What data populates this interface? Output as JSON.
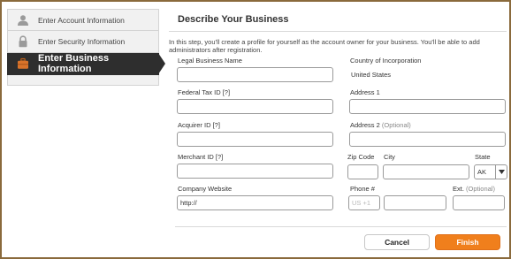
{
  "sidebar": {
    "items": [
      {
        "label": "Enter Account Information",
        "icon": "user-icon"
      },
      {
        "label": "Enter Security Information",
        "icon": "lock-icon"
      },
      {
        "label": "Enter Business Information",
        "icon": "briefcase-icon"
      }
    ]
  },
  "main": {
    "title": "Describe Your Business",
    "intro": "In this step, you'll create a profile for yourself as the account owner for your business. You'll be able to add administrators after registration."
  },
  "form": {
    "legal_business_name": {
      "label": "Legal Business Name",
      "value": ""
    },
    "country": {
      "label": "Country of Incorporation",
      "value": "United States"
    },
    "federal_tax_id": {
      "label": "Federal Tax ID [?]",
      "value": ""
    },
    "address1": {
      "label": "Address 1",
      "value": ""
    },
    "acquirer_id": {
      "label": "Acquirer ID  [?]",
      "value": ""
    },
    "address2": {
      "label": "Address 2",
      "optional": "(Optional)",
      "value": ""
    },
    "merchant_id": {
      "label": "Merchant ID [?]",
      "value": ""
    },
    "zip": {
      "label": "Zip Code",
      "value": ""
    },
    "city": {
      "label": "City",
      "value": ""
    },
    "state": {
      "label": "State",
      "value": "AK"
    },
    "company_website": {
      "label": "Company Website",
      "value": "http://"
    },
    "phone": {
      "label": "Phone #",
      "country_code_placeholder": "US +1",
      "value": ""
    },
    "ext": {
      "label": "Ext.",
      "optional": "(Optional)",
      "value": ""
    }
  },
  "actions": {
    "cancel_label": "Cancel",
    "finish_label": "Finish"
  },
  "colors": {
    "accent": "#f07f1c",
    "active_step_bg": "#2e2e2e",
    "frame_border": "#8a6a3c"
  }
}
